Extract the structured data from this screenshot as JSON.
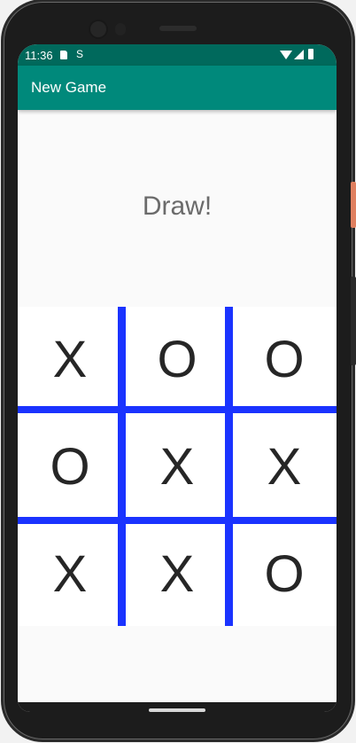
{
  "status_bar": {
    "time": "11:36",
    "sync_glyph": "S",
    "icons": [
      "sim-card-icon",
      "sync-icon",
      "wifi-icon",
      "cell-signal-icon",
      "battery-icon"
    ]
  },
  "app_bar": {
    "title": "New Game",
    "color": "#00897b"
  },
  "game": {
    "result": "Draw!",
    "line_color": "#1a33ff",
    "board": [
      [
        "X",
        "O",
        "O"
      ],
      [
        "O",
        "X",
        "X"
      ],
      [
        "X",
        "X",
        "O"
      ]
    ]
  }
}
